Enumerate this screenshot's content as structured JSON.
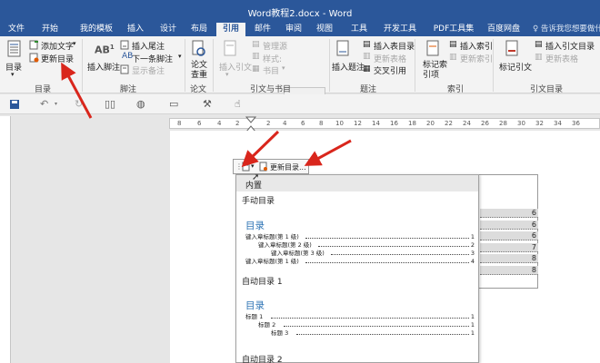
{
  "window": {
    "title": "Word教程2.docx - Word"
  },
  "tabs": [
    "文件",
    "开始",
    "我的模板",
    "插入",
    "设计",
    "布局",
    "引用",
    "邮件",
    "审阅",
    "视图",
    "工具",
    "开发工具",
    "PDF工具集",
    "百度网盘"
  ],
  "active_tab": "引用",
  "tell_me": "♀ 告诉我您想要做什么",
  "ribbon": {
    "toc_group": {
      "toc_button": "目录",
      "add_text": "添加文字",
      "update_toc": "更新目录",
      "group_label": "目录"
    },
    "footnote_group": {
      "insert_footnote": "插入脚注",
      "insert_endnote": "插入尾注",
      "next_footnote": "下一条脚注",
      "show_notes": "显示备注",
      "group_label": "脚注"
    },
    "paper_group": {
      "paper_check": "论文查重",
      "group_label": "论文"
    },
    "citation_group": {
      "insert_citation": "插入引文",
      "manage_sources": "管理源",
      "style": "样式:",
      "bibliography": "书目",
      "group_label": "引文与书目"
    },
    "caption_group": {
      "insert_caption": "插入题注",
      "insert_table_of_figures": "插入表目录",
      "update_table": "更新表格",
      "cross_reference": "交叉引用",
      "group_label": "题注"
    },
    "index_group": {
      "mark_entry": "标记索引项",
      "insert_index": "插入索引",
      "update_index": "更新索引",
      "group_label": "索引"
    },
    "toa_group": {
      "mark_citation": "标记引文",
      "insert_toa": "插入引文目录",
      "update_toa": "更新表格",
      "group_label": "引文目录"
    }
  },
  "ruler_numbers": [
    "8",
    "6",
    "4",
    "2",
    "2",
    "4",
    "6",
    "8",
    "10",
    "12",
    "14",
    "16",
    "18",
    "20",
    "22",
    "24",
    "26",
    "28",
    "30",
    "32",
    "34",
    "36"
  ],
  "minibar": {
    "update_label": "更新目录..."
  },
  "popup": {
    "section_builtin": "内置",
    "manual_toc": "手动目录",
    "toc1_title": "目录",
    "toc1_lines": [
      {
        "text": "键入章标题(第 1 级)",
        "page": "1"
      },
      {
        "text": "键入章标题(第 2 级)",
        "page": "2"
      },
      {
        "text": "键入章标题(第 3 级)",
        "page": "3"
      },
      {
        "text": "键入章标题(第 1 级)",
        "page": "4"
      }
    ],
    "auto_toc_1": "自动目录 1",
    "toc2_title": "目录",
    "toc2_lines": [
      {
        "text": "标题 1",
        "page": "1"
      },
      {
        "text": "标题 2",
        "page": "1"
      },
      {
        "text": "标题 3",
        "page": "1"
      }
    ],
    "auto_toc_2": "自动目录 2"
  },
  "doc_page_numbers": [
    "6",
    "6",
    "6",
    "7",
    "8",
    "8"
  ]
}
